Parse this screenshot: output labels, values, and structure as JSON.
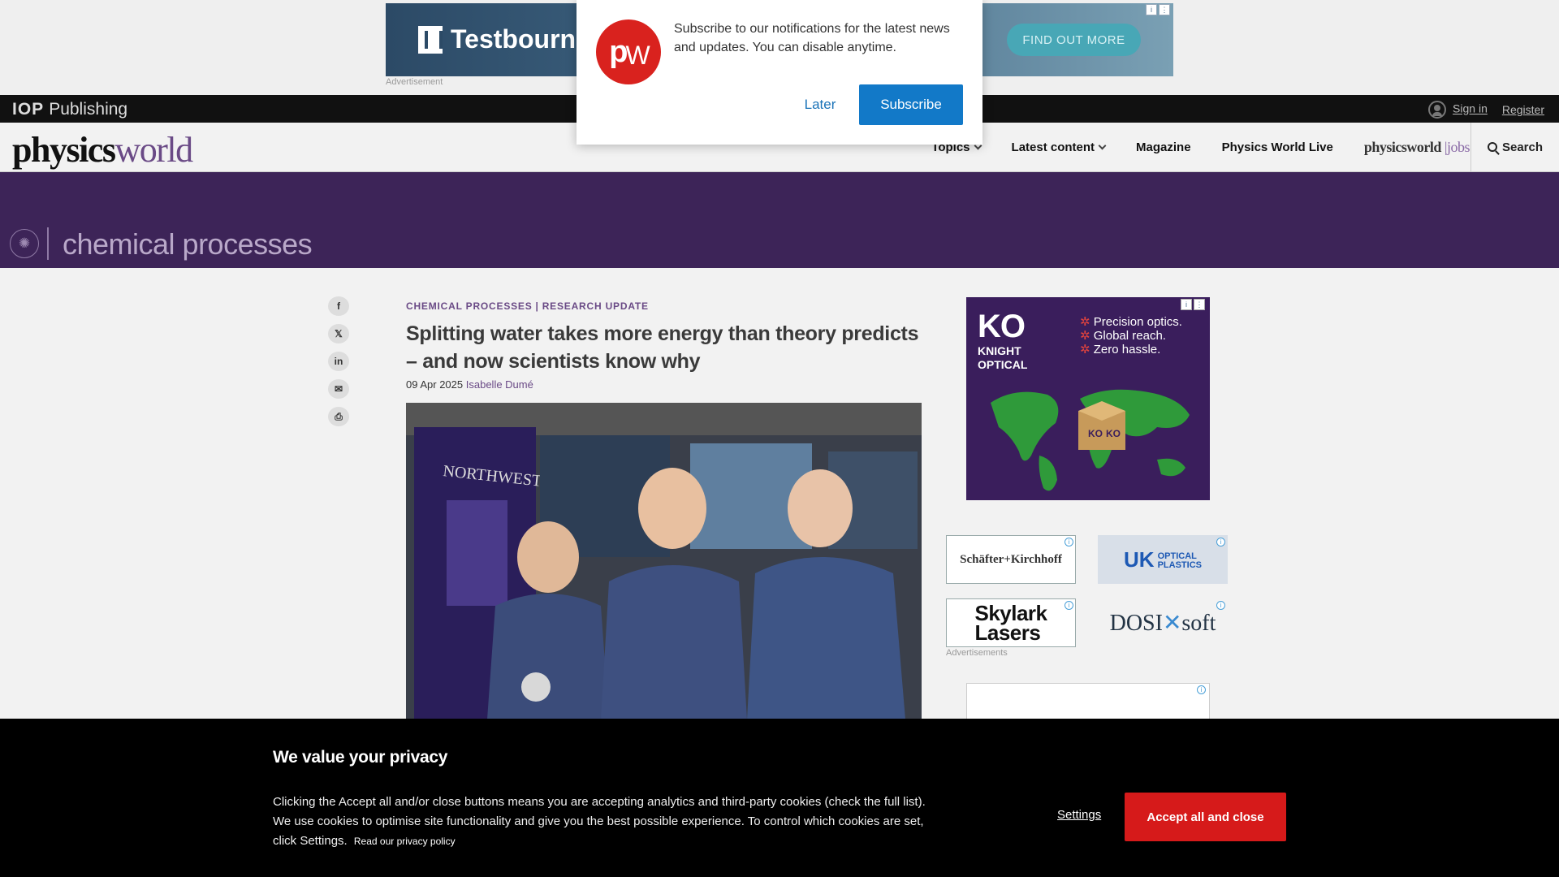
{
  "top_ad": {
    "brand": "Testbourne",
    "cta": "FIND OUT MORE",
    "label": "Advertisement"
  },
  "iop": {
    "logo_bold": "IOP",
    "logo_text": "Publishing",
    "sign_in": "Sign in",
    "register": "Register"
  },
  "nav": {
    "logo_part1": "physics",
    "logo_part2": "world",
    "items": {
      "topics": "Topics",
      "latest": "Latest content",
      "magazine": "Magazine",
      "live": "Physics World Live"
    },
    "jobs_part1": "physicsworld",
    "jobs_part2": "jobs",
    "search": "Search"
  },
  "topic": {
    "title": "chemical processes"
  },
  "article": {
    "category1": "CHEMICAL PROCESSES",
    "category2": "RESEARCH UPDATE",
    "headline": "Splitting water takes more energy than theory predicts – and now scientists know why",
    "date": "09 Apr 2025",
    "author": "Isabelle Dumé",
    "banner_text": "NORTHWESTERN"
  },
  "sidebar": {
    "ko_brand": "KO",
    "ko_name_line1": "KNIGHT",
    "ko_name_line2": "OPTICAL",
    "ko_bullets": [
      "Precision optics.",
      "Global reach.",
      "Zero hassle."
    ],
    "ad1": "Schäfter+Kirchhoff",
    "ad2_big": "UK",
    "ad2_small1": "OPTICAL",
    "ad2_small2": "PLASTICS",
    "ad3_line1": "Skylark",
    "ad3_line2": "Lasers",
    "ad4_a": "DOSI",
    "ad4_b": "soft",
    "ads_label": "Advertisements"
  },
  "notification": {
    "message": "Subscribe to our notifications for the latest news and updates. You can disable anytime.",
    "later": "Later",
    "subscribe": "Subscribe",
    "logo_p": "p",
    "logo_w": "W"
  },
  "cookie": {
    "title": "We value your privacy",
    "body": "Clicking the Accept all and/or close buttons means you are accepting analytics and third-party cookies (check the full list). We use cookies to optimise site functionality and give you the best possible experience. To control which cookies are set, click Settings.",
    "privacy_link": "Read our privacy policy",
    "settings": "Settings",
    "accept": "Accept all and close"
  },
  "colors": {
    "brand_purple": "#3d2458",
    "accent_red": "#d61a1a",
    "subscribe_blue": "#1279c8"
  }
}
